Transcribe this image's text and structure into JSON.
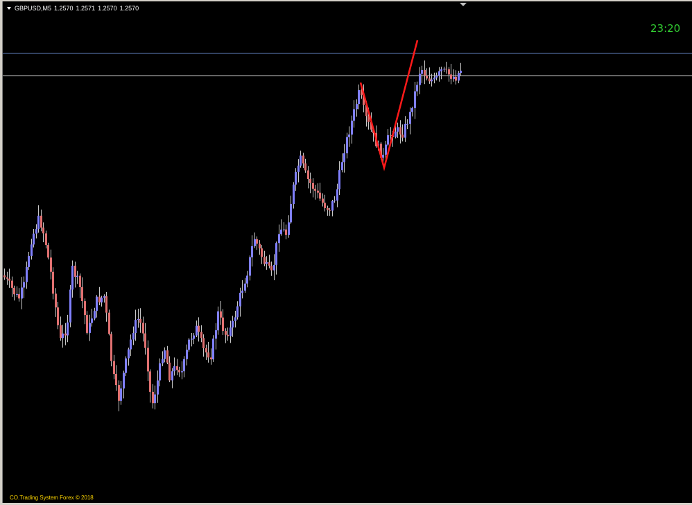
{
  "header": {
    "symbol": "GBPUSD,M5",
    "open": "1.2570",
    "high": "1.2571",
    "low": "1.2570",
    "close": "1.2570"
  },
  "clock": "23:20",
  "footer": {
    "copyright": "CO.Trading System Forex © 2018"
  },
  "colors": {
    "background": "#000000",
    "bull_candle": "#8080ff",
    "bear_candle": "#e07070",
    "wick": "#c8c8c8",
    "level_line_upper": "#5f7fbf",
    "level_line_lower": "#c8c8c8",
    "zigzag": "#ff1a1a",
    "clock": "#32cd32",
    "copyright": "#ffd700"
  },
  "icons": {
    "symbol_menu": "triangle-down-icon",
    "shift_marker": "triangle-down-icon"
  }
}
